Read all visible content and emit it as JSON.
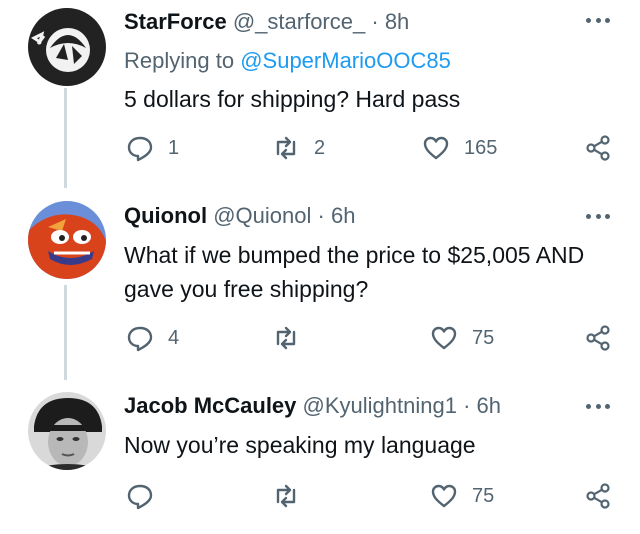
{
  "tweets": [
    {
      "name": "StarForce",
      "handle": "@_starforce_",
      "sep": "·",
      "time": "8h",
      "replying_prefix": "Replying to",
      "replying_handle": "@SuperMarioOOC85",
      "text": "5 dollars for shipping? Hard pass",
      "replies": "1",
      "retweets": "2",
      "likes": "165"
    },
    {
      "name": "Quionol",
      "handle": "@Quionol",
      "sep": "·",
      "time": "6h",
      "text": "What if we bumped the price to $25,005 AND gave you free shipping?",
      "replies": "4",
      "retweets": "",
      "likes": "75"
    },
    {
      "name": "Jacob McCauley",
      "handle": "@Kyulightning1",
      "sep": "·",
      "time": "6h",
      "text": "Now you’re speaking my language",
      "replies": "",
      "retweets": "",
      "likes": "75"
    }
  ],
  "icons": {
    "reply": "reply-icon",
    "retweet": "retweet-icon",
    "like": "heart-icon",
    "share": "share-icon",
    "more": "more-icon"
  },
  "colors": {
    "link": "#1d9bf0",
    "secondary": "#536471",
    "thread_line": "#cfd9de"
  }
}
